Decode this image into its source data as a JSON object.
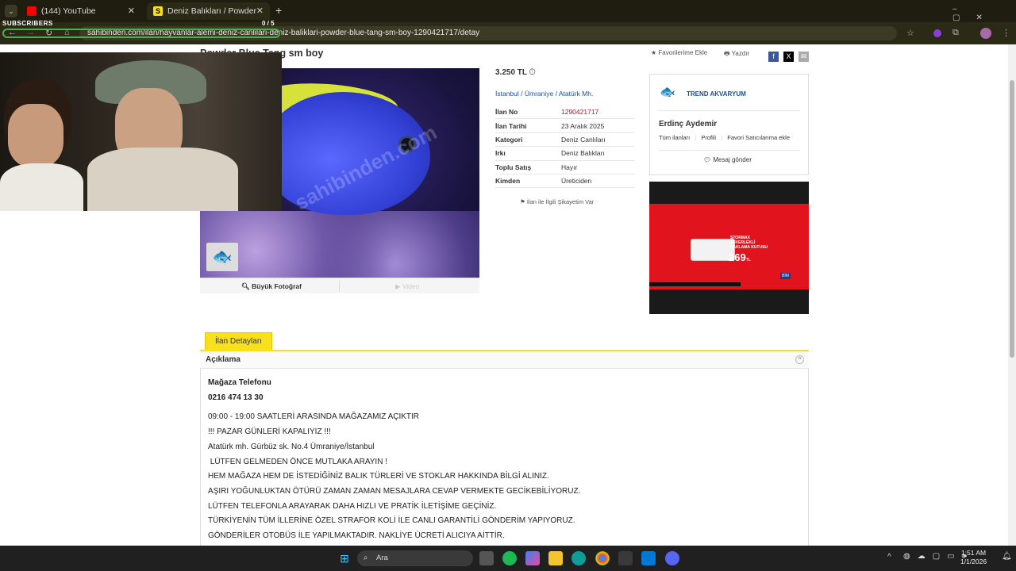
{
  "browser": {
    "tabs": [
      {
        "label": "(144) YouTube"
      },
      {
        "label": "Deniz Balıkları / Powder Blue Ta"
      }
    ],
    "url": "sahibinden.com/ilan/hayvanlar-alemi-deniz-canlilari-deniz-baliklari-powder-blue-tang-sm-boy-1290421717/detay",
    "overlay_label": "SUBSCRIBERS",
    "overlay_count": "0 / 5"
  },
  "listing": {
    "title": "Powder Blue Tang sm boy",
    "actions": {
      "favorite": "Favorilerime Ekle",
      "print": "Yazdır"
    },
    "photo_watermark": "sahibinden.com",
    "photo_tabs": {
      "big_photo": "Büyük Fotoğraf",
      "video": "Video"
    },
    "price": "3.250 TL",
    "location": [
      "İstanbul",
      "Ümraniye",
      "Atatürk Mh."
    ],
    "info": [
      {
        "key": "İlan No",
        "value": "1290421717"
      },
      {
        "key": "İlan Tarihi",
        "value": "23 Aralık 2025"
      },
      {
        "key": "Kategori",
        "value": "Deniz Canlıları"
      },
      {
        "key": "Irkı",
        "value": "Deniz Balıkları"
      },
      {
        "key": "Toplu Satış",
        "value": "Hayır"
      },
      {
        "key": "Kimden",
        "value": "Üreticiden"
      }
    ],
    "complaint": "İlan ile İlgili Şikayetim Var"
  },
  "store": {
    "name": "TREND AKVARYUM",
    "seller": "Erdinç Aydemir",
    "links": [
      "Tüm ilanları",
      "Profili",
      "Favori Satıcılarıma ekle"
    ],
    "message": "Mesaj gönder"
  },
  "ad": {
    "headline": "STORMAX TEKERLEKLİ SAKLAMA KUTUSU",
    "price": "269",
    "currency": "TL",
    "brand": "BİM"
  },
  "details": {
    "tab": "İlan Detayları",
    "section": "Açıklama",
    "phone_label": "Mağaza Telefonu",
    "phone": "0216 474 13 30",
    "lines": [
      "09:00 - 19:00 SAATLERİ ARASINDA MAĞAZAMIZ AÇIKTIR",
      "!!! PAZAR GÜNLERİ KAPALIYIZ !!!",
      "Atatürk mh. Gürbüz sk. No.4 Ümraniye/İstanbul",
      " LÜTFEN GELMEDEN ÖNCE MUTLAKA ARAYIN !",
      "HEM MAĞAZA HEM DE İSTEDİĞİNİZ BALIK TÜRLERİ VE STOKLAR HAKKINDA BİLGİ ALINIZ.",
      "AŞIRI YOĞUNLUKTAN ÖTÜRÜ ZAMAN ZAMAN MESAJLARA CEVAP VERMEKTE GECİKEBİLİYORUZ.",
      "LÜTFEN TELEFONLA ARAYARAK DAHA HIZLI VE PRATİK İLETİŞİME GEÇİNİZ.",
      "TÜRKİYENİN TÜM İLLERİNE ÖZEL STRAFOR KOLİ İLE CANLI GARANTİLİ GÖNDERİM YAPIYORUZ.",
      "GÖNDERİLER OTOBÜS İLE YAPILMAKTADIR. NAKLİYE ÜCRETİ ALICIYA AİTTİR."
    ]
  },
  "taskbar": {
    "search": "Ara",
    "time": "1:51 AM",
    "date": "1/1/2026"
  }
}
